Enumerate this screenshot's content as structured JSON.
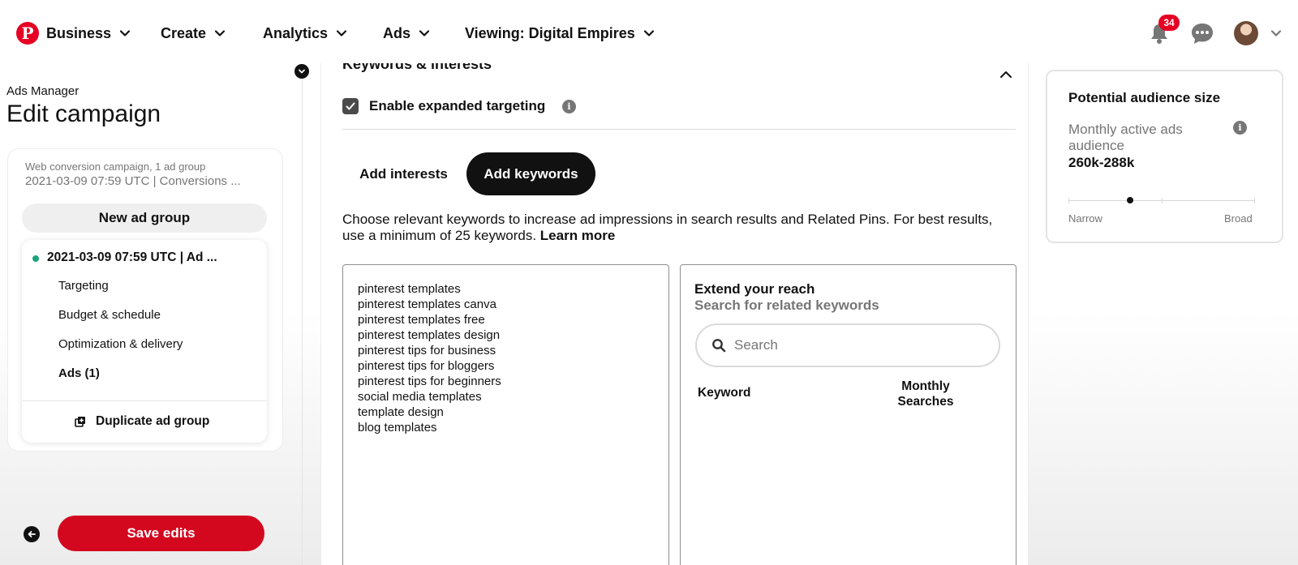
{
  "nav": {
    "business": "Business",
    "create": "Create",
    "analytics": "Analytics",
    "ads": "Ads",
    "viewing": "Viewing: Digital Empires",
    "notification_count": "34"
  },
  "sidebar": {
    "breadcrumb": "Ads Manager",
    "title": "Edit campaign",
    "campaign_meta1": "Web conversion campaign, 1 ad group",
    "campaign_meta2": "2021-03-09 07:59 UTC | Conversions ...",
    "new_ad_group": "New ad group",
    "ad_group": {
      "name": "2021-03-09 07:59 UTC | Ad ...",
      "items": [
        {
          "label": "Targeting"
        },
        {
          "label": "Budget & schedule"
        },
        {
          "label": "Optimization & delivery"
        },
        {
          "label": "Ads (1)"
        }
      ],
      "duplicate": "Duplicate ad group"
    },
    "save": "Save edits"
  },
  "main": {
    "section_title": "Keywords & interests",
    "expanded_targeting": {
      "label": "Enable expanded targeting",
      "checked": true
    },
    "tabs": [
      {
        "label": "Add interests",
        "active": false
      },
      {
        "label": "Add keywords",
        "active": true
      }
    ],
    "description": "Choose relevant keywords to increase ad impressions in search results and Related Pins. For best results, use a minimum of 25 keywords.",
    "learn_more": "Learn more",
    "keywords": [
      "pinterest templates",
      "pinterest templates canva",
      "pinterest templates free",
      "pinterest templates design",
      "pinterest tips for business",
      "pinterest tips for bloggers",
      "pinterest tips for beginners",
      "social media templates",
      "template design",
      "blog templates"
    ],
    "reach": {
      "title": "Extend your reach",
      "subtitle": "Search for related keywords",
      "search_placeholder": "Search",
      "col_keyword": "Keyword",
      "col_monthly": "Monthly Searches"
    }
  },
  "audience": {
    "title": "Potential audience size",
    "label": "Monthly active ads audience",
    "value": "260k-288k",
    "narrow": "Narrow",
    "broad": "Broad",
    "slider_position": 0.33
  },
  "colors": {
    "brand_red": "#e60023",
    "save_red": "#d3081f",
    "status_green": "#1aa37a"
  }
}
